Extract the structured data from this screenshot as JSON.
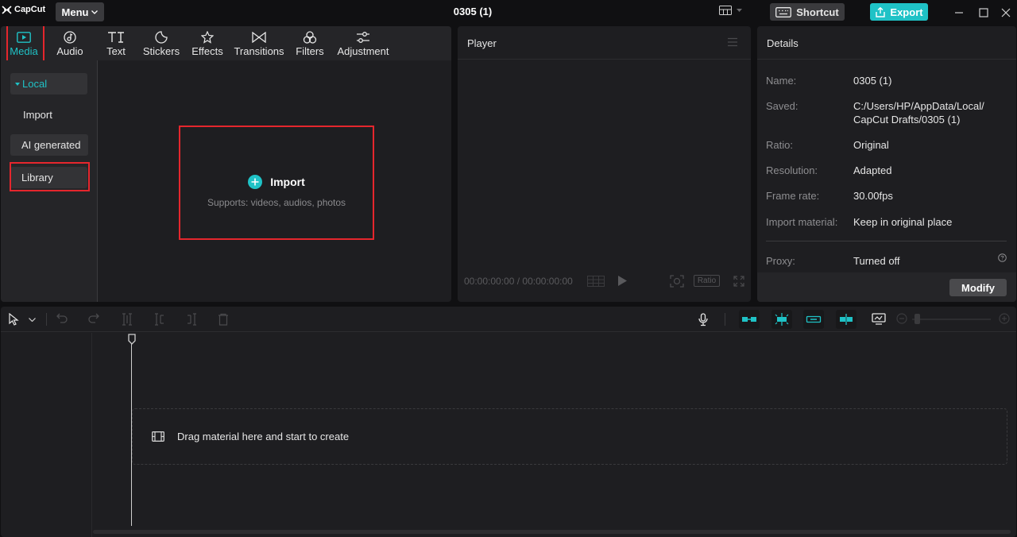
{
  "app": {
    "logo_text": "CapCut",
    "menu_label": "Menu",
    "project_title": "0305 (1)"
  },
  "titlebar": {
    "shortcut_label": "Shortcut",
    "export_label": "Export"
  },
  "tabs": [
    {
      "label": "Media",
      "icon": "media-icon",
      "active": true
    },
    {
      "label": "Audio",
      "icon": "audio-icon"
    },
    {
      "label": "Text",
      "icon": "text-icon"
    },
    {
      "label": "Stickers",
      "icon": "stickers-icon"
    },
    {
      "label": "Effects",
      "icon": "effects-icon"
    },
    {
      "label": "Transitions",
      "icon": "transitions-icon"
    },
    {
      "label": "Filters",
      "icon": "filters-icon"
    },
    {
      "label": "Adjustment",
      "icon": "adjustment-icon"
    }
  ],
  "sidebar": {
    "local_label": "Local",
    "import_label": "Import",
    "ai_label": "AI generated",
    "library_label": "Library"
  },
  "import_area": {
    "title": "Import",
    "subtitle": "Supports: videos, audios, photos"
  },
  "player": {
    "title": "Player",
    "current_time": "00:00:00:00",
    "total_time": "00:00:00:00",
    "ratio_label": "Ratio"
  },
  "details": {
    "title": "Details",
    "rows": [
      {
        "label": "Name:",
        "value": "0305 (1)"
      },
      {
        "label": "Saved:",
        "value": "C:/Users/HP/AppData/Local/",
        "value2": "CapCut Drafts/0305 (1)"
      },
      {
        "label": "Ratio:",
        "value": "Original"
      },
      {
        "label": "Resolution:",
        "value": "Adapted"
      },
      {
        "label": "Frame rate:",
        "value": "30.00fps"
      },
      {
        "label": "Import material:",
        "value": "Keep in original place"
      },
      {
        "label": "Proxy:",
        "value": "Turned off"
      }
    ],
    "modify_label": "Modify"
  },
  "timeline": {
    "drop_text": "Drag material here and start to create"
  },
  "colors": {
    "accent": "#1fc2c6",
    "highlight": "#e5262d",
    "panel": "#1e1e21"
  }
}
